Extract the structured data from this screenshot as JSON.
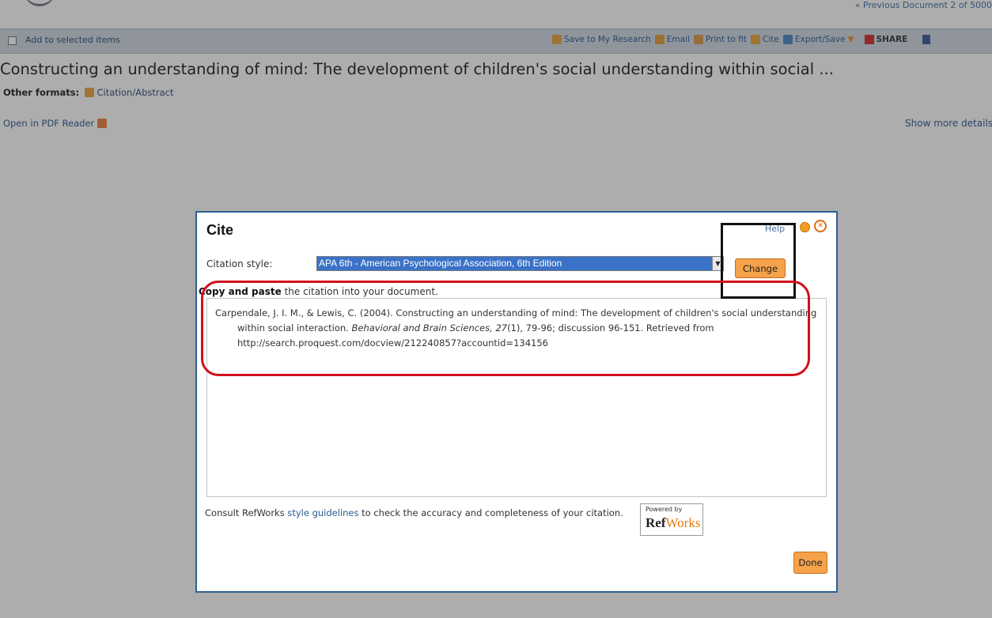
{
  "header": {
    "prev_nav": "« Previous  Document 2 of 5000"
  },
  "toolbar": {
    "add_to_selected": "Add to selected items",
    "save_research": "Save to My Research",
    "email": "Email",
    "print": "Print to fit",
    "cite": "Cite",
    "export": "Export/Save",
    "share": "SHARE"
  },
  "document": {
    "title": "Constructing an understanding of mind: The development of children's social understanding within social ...",
    "other_formats_label": "Other formats:",
    "other_formats_link": "Citation/Abstract",
    "open_pdf": "Open in PDF Reader",
    "show_more": "Show more details"
  },
  "modal": {
    "title": "Cite",
    "help": "Help",
    "citation_style_label": "Citation style:",
    "citation_style_value": "APA 6th - American Psychological Association, 6th Edition",
    "change_button": "Change",
    "copy_instruction_bold": "Copy and paste",
    "copy_instruction_rest": " the citation into your document.",
    "citation": {
      "part1": "Carpendale, J. I. M., & Lewis, C. (2004). Constructing an understanding of mind: The development of children's social understanding within social interaction. ",
      "journal": "Behavioral and Brain Sciences, 27",
      "part2": "(1), 79-96; discussion 96-151. Retrieved from http://search.proquest.com/docview/212240857?accountid=134156"
    },
    "consult_prefix": "Consult RefWorks ",
    "consult_link": "style guidelines",
    "consult_suffix": " to check the accuracy and completeness of your citation.",
    "powered_by": "Powered by",
    "refworks_ref": "Ref",
    "refworks_works": "Works",
    "done_button": "Done"
  },
  "colors": {
    "accent_button": "#f5a24a",
    "modal_border": "#2e5f92",
    "annotation_red": "#d0101e"
  }
}
